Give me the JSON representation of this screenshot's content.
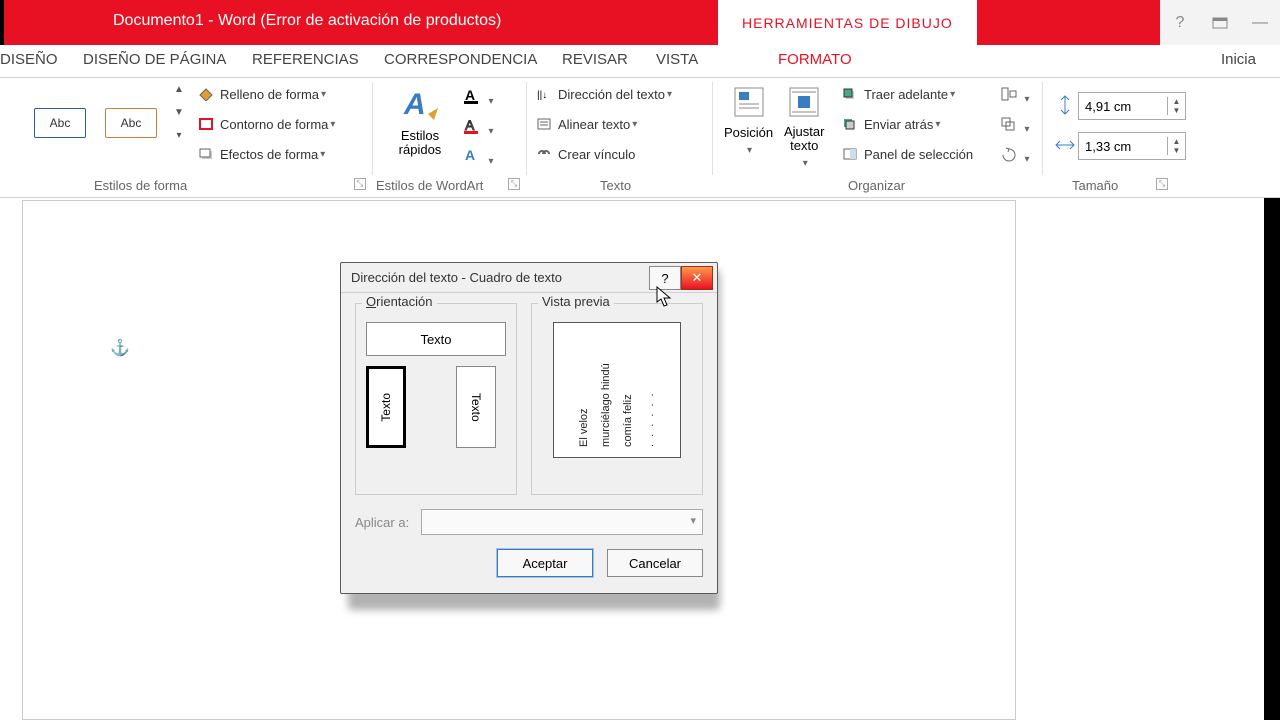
{
  "titlebar": {
    "title": "Documento1  -  Word (Error de activación de productos)",
    "tool_tab": "HERRAMIENTAS DE DIBUJO"
  },
  "tabs": {
    "diseno": "DISEÑO",
    "diseno_pagina": "DISEÑO DE PÁGINA",
    "referencias": "REFERENCIAS",
    "correspondencia": "CORRESPONDENCIA",
    "revisar": "REVISAR",
    "vista": "VISTA",
    "formato": "FORMATO",
    "signin": "Inicia"
  },
  "ribbon": {
    "style_abc": "Abc",
    "relleno": "Relleno de forma",
    "contorno": "Contorno de forma",
    "efectos": "Efectos de forma",
    "estilos_rapidos": "Estilos\nrápidos",
    "direccion_texto": "Dirección del texto",
    "alinear_texto": "Alinear texto",
    "crear_vinculo": "Crear vínculo",
    "posicion": "Posición",
    "ajustar_texto": "Ajustar\ntexto",
    "traer_adelante": "Traer adelante",
    "enviar_atras": "Enviar atrás",
    "panel_seleccion": "Panel de selección",
    "height": "4,91 cm",
    "width": "1,33 cm",
    "group_estilos_forma": "Estilos de forma",
    "group_estilos_wordart": "Estilos de WordArt",
    "group_texto": "Texto",
    "group_organizar": "Organizar",
    "group_tamano": "Tamaño"
  },
  "dialog": {
    "title": "Dirección del texto - Cuadro de texto",
    "orientacion": "Orientación",
    "vista_previa": "Vista previa",
    "texto_h": "Texto",
    "texto_v": "Texto",
    "preview_line1": "El veloz",
    "preview_line2": "murciélago hindú",
    "preview_line3": "comía feliz",
    "preview_line4": ". . .   . . .",
    "aplicar_a": "Aplicar a:",
    "aceptar": "Aceptar",
    "cancelar": "Cancelar"
  }
}
